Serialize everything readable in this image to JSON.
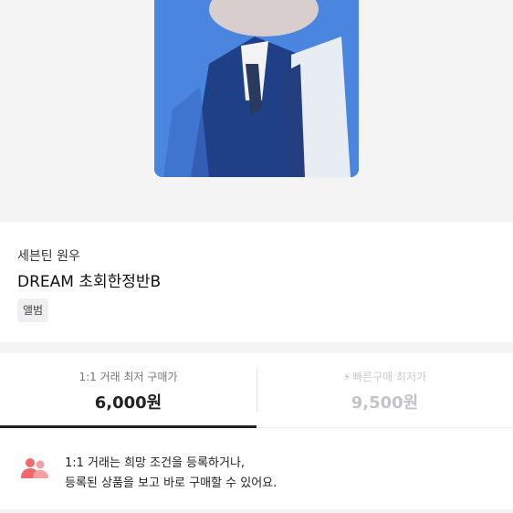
{
  "product": {
    "artist": "세븐틴 원우",
    "title": "DREAM 초회한정반B",
    "category_tag": "앨범"
  },
  "prices": {
    "direct": {
      "label": "1:1 거래 최저 구매가",
      "value": "6,000원",
      "active": true
    },
    "quick": {
      "icon": "lightning-icon",
      "label": "빠른구매 최저가",
      "value": "9,500원",
      "active": false
    }
  },
  "notice": {
    "icon": "users-icon",
    "line1": "1:1 거래는 희망 조건을 등록하거나,",
    "line2": "등록된 상품을 보고 바로 구매할 수 있어요."
  },
  "colors": {
    "photo_blue": "#3f7bd6",
    "notice_icon": "#f06a6a",
    "quick_accent": "#c2b5f0"
  }
}
